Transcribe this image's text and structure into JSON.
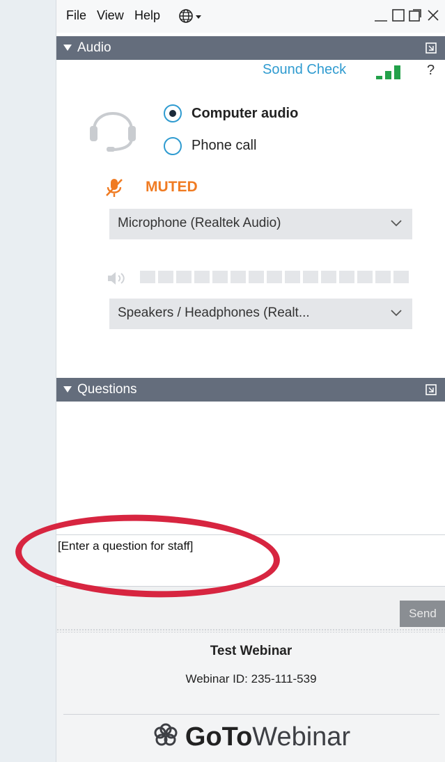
{
  "menu": {
    "file": "File",
    "view": "View",
    "help": "Help",
    "language_icon": "globe-icon"
  },
  "audio": {
    "header": "Audio",
    "sound_check": "Sound Check",
    "help_label": "?",
    "option_computer": "Computer audio",
    "option_phone": "Phone call",
    "selected_option": "Computer audio",
    "muted_label": "MUTED",
    "microphone_select": "Microphone (Realtek Audio)",
    "speaker_select": "Speakers / Headphones (Realt...",
    "accent_color": "#2f9bd0",
    "muted_color": "#f07b22"
  },
  "questions": {
    "header": "Questions",
    "input_placeholder": "[Enter a question for staff]",
    "send_label": "Send"
  },
  "footer": {
    "webinar_title": "Test Webinar",
    "webinar_id": "Webinar ID: 235-111-539",
    "brand_bold": "GoTo",
    "brand_rest": "Webinar"
  },
  "annotation_color": "#d72540"
}
